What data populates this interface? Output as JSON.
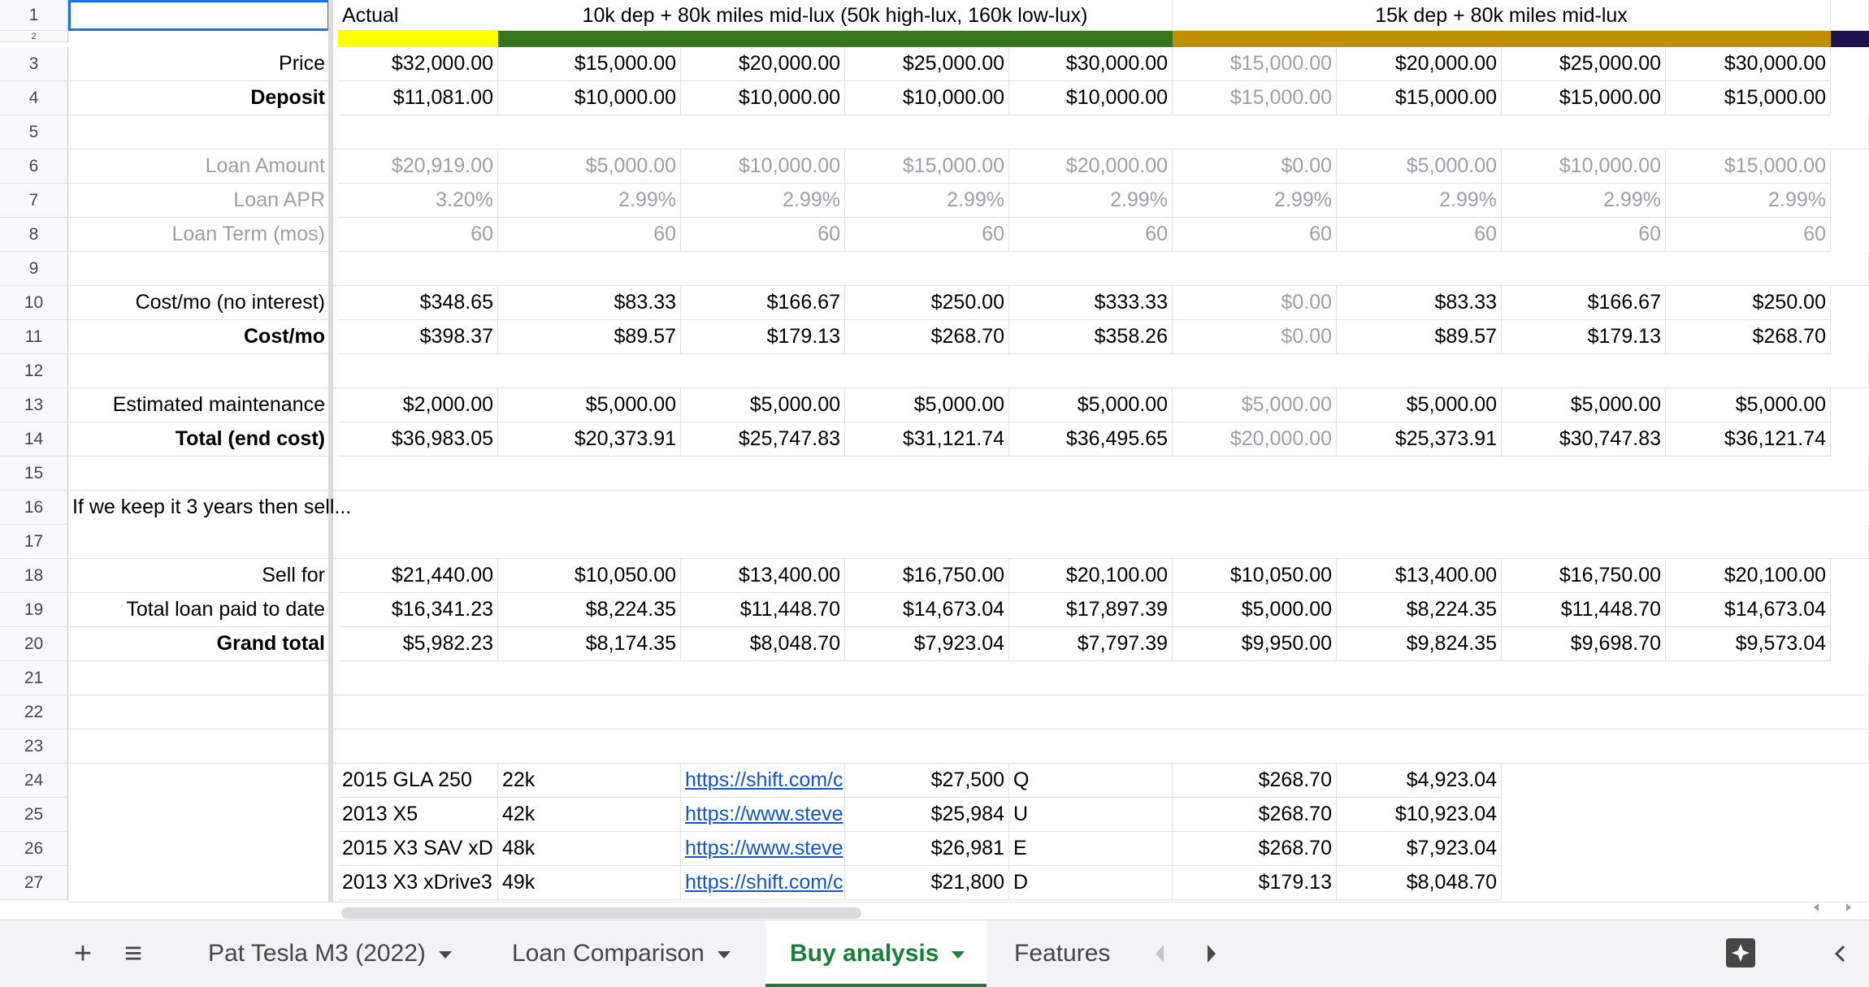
{
  "row_numbers": [
    "1",
    "2",
    "3",
    "4",
    "5",
    "6",
    "7",
    "8",
    "9",
    "10",
    "11",
    "12",
    "13",
    "14",
    "15",
    "16",
    "17",
    "18",
    "19",
    "20",
    "21",
    "22",
    "23",
    "24",
    "25",
    "26",
    "27"
  ],
  "header": {
    "actual": "Actual",
    "group1": "10k dep + 80k miles mid-lux (50k high-lux, 160k low-lux)",
    "group2": "15k dep + 80k miles mid-lux"
  },
  "colors": {
    "actual_band": "#ffff00",
    "group1_band": "#38761d",
    "group2_band": "#bf9000",
    "extra_band": "#20124d",
    "link": "#1155cc",
    "active_tab": "#188038"
  },
  "rows": {
    "price": {
      "label": "Price",
      "vals": [
        "$32,000.00",
        "$15,000.00",
        "$20,000.00",
        "$25,000.00",
        "$30,000.00",
        "$15,000.00",
        "$20,000.00",
        "$25,000.00",
        "$30,000.00"
      ]
    },
    "deposit": {
      "label": "Deposit",
      "vals": [
        "$11,081.00",
        "$10,000.00",
        "$10,000.00",
        "$10,000.00",
        "$10,000.00",
        "$15,000.00",
        "$15,000.00",
        "$15,000.00",
        "$15,000.00"
      ]
    },
    "loan_amount": {
      "label": "Loan Amount",
      "vals": [
        "$20,919.00",
        "$5,000.00",
        "$10,000.00",
        "$15,000.00",
        "$20,000.00",
        "$0.00",
        "$5,000.00",
        "$10,000.00",
        "$15,000.00"
      ]
    },
    "loan_apr": {
      "label": "Loan APR",
      "vals": [
        "3.20%",
        "2.99%",
        "2.99%",
        "2.99%",
        "2.99%",
        "2.99%",
        "2.99%",
        "2.99%",
        "2.99%"
      ]
    },
    "loan_term": {
      "label": "Loan Term (mos)",
      "vals": [
        "60",
        "60",
        "60",
        "60",
        "60",
        "60",
        "60",
        "60",
        "60"
      ]
    },
    "cost_no_interest": {
      "label": "Cost/mo (no interest)",
      "vals": [
        "$348.65",
        "$83.33",
        "$166.67",
        "$250.00",
        "$333.33",
        "$0.00",
        "$83.33",
        "$166.67",
        "$250.00"
      ]
    },
    "cost_mo": {
      "label": "Cost/mo",
      "vals": [
        "$398.37",
        "$89.57",
        "$179.13",
        "$268.70",
        "$358.26",
        "$0.00",
        "$89.57",
        "$179.13",
        "$268.70"
      ]
    },
    "maintenance": {
      "label": "Estimated maintenance",
      "vals": [
        "$2,000.00",
        "$5,000.00",
        "$5,000.00",
        "$5,000.00",
        "$5,000.00",
        "$5,000.00",
        "$5,000.00",
        "$5,000.00",
        "$5,000.00"
      ]
    },
    "total_end": {
      "label": "Total (end cost)",
      "vals": [
        "$36,983.05",
        "$20,373.91",
        "$25,747.83",
        "$31,121.74",
        "$36,495.65",
        "$20,000.00",
        "$25,373.91",
        "$30,747.83",
        "$36,121.74"
      ]
    },
    "note": "If we keep it 3 years then sell...",
    "sell_for": {
      "label": "Sell for",
      "vals": [
        "$21,440.00",
        "$10,050.00",
        "$13,400.00",
        "$16,750.00",
        "$20,100.00",
        "$10,050.00",
        "$13,400.00",
        "$16,750.00",
        "$20,100.00"
      ]
    },
    "loan_paid": {
      "label": "Total loan paid to date",
      "vals": [
        "$16,341.23",
        "$8,224.35",
        "$11,448.70",
        "$14,673.04",
        "$17,897.39",
        "$5,000.00",
        "$8,224.35",
        "$11,448.70",
        "$14,673.04"
      ]
    },
    "grand_total": {
      "label": "Grand total",
      "vals": [
        "$5,982.23",
        "$8,174.35",
        "$8,048.70",
        "$7,923.04",
        "$7,797.39",
        "$9,950.00",
        "$9,824.35",
        "$9,698.70",
        "$9,573.04"
      ]
    }
  },
  "cars": [
    {
      "model": "2015 GLA 250",
      "miles": "22k",
      "link": "https://shift.com/c",
      "price": "$27,500",
      "grade": "Q",
      "cost": "$268.70",
      "total": "$4,923.04"
    },
    {
      "model": "2013 X5",
      "miles": "42k",
      "link": "https://www.steve",
      "price": "$25,984",
      "grade": "U",
      "cost": "$268.70",
      "total": "$10,923.04"
    },
    {
      "model": "2015 X3 SAV xD",
      "miles": "48k",
      "link": "https://www.steve",
      "price": "$26,981",
      "grade": "E",
      "cost": "$268.70",
      "total": "$7,923.04"
    },
    {
      "model": "2013 X3 xDrive3",
      "miles": "49k",
      "link": "https://shift.com/c",
      "price": "$21,800",
      "grade": "D",
      "cost": "$179.13",
      "total": "$8,048.70"
    }
  ],
  "tabs": {
    "add": "+",
    "menu": "≡",
    "items": [
      "Pat Tesla M3 (2022)",
      "Loan Comparison",
      "Buy analysis",
      "Features"
    ]
  }
}
